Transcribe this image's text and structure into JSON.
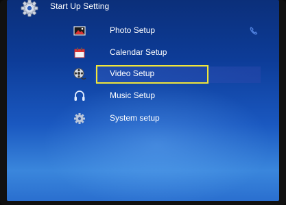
{
  "header": {
    "title": "Start Up Setting",
    "icon": "gear-icon"
  },
  "menu": {
    "items": [
      {
        "label": "Photo Setup",
        "icon": "photo-icon"
      },
      {
        "label": "Calendar Setup",
        "icon": "calendar-icon"
      },
      {
        "label": "Video Setup",
        "icon": "film-reel-icon",
        "selected": true
      },
      {
        "label": "Music Setup",
        "icon": "headphones-icon"
      },
      {
        "label": "System setup",
        "icon": "gear-icon"
      }
    ]
  },
  "status": {
    "icon": "phone-icon"
  },
  "colors": {
    "background": "#1a58c0",
    "highlight_border": "#f1e63a",
    "text": "#ffffff"
  }
}
